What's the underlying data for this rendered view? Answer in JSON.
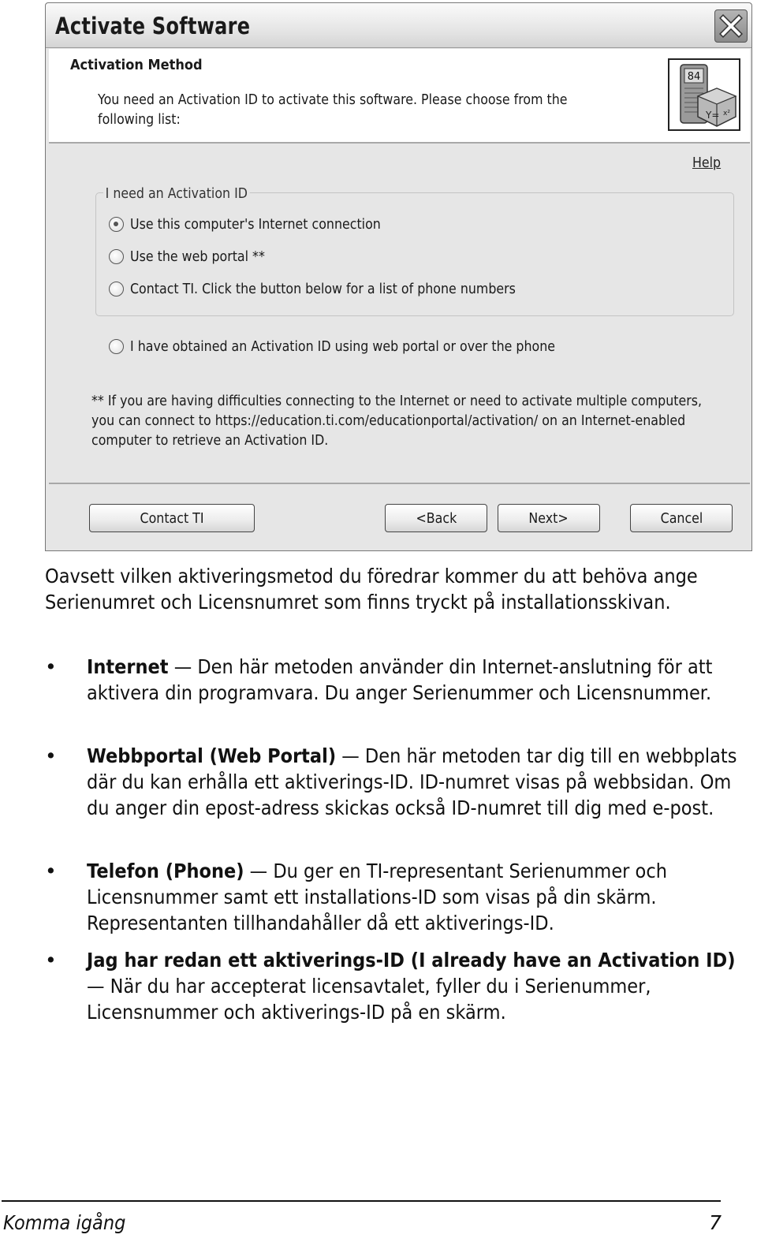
{
  "dialog": {
    "title": "Activate Software",
    "close_icon": "close-x-icon",
    "header": {
      "heading": "Activation Method",
      "description": "You need an Activation ID to activate this software. Please choose from the following list:",
      "app_icon": "ti84-calculator-cube-icon",
      "app_icon_text": "84"
    },
    "help_link": "Help",
    "group": {
      "legend": "I need an Activation ID",
      "options": [
        {
          "label": "Use this computer's Internet connection",
          "checked": true
        },
        {
          "label": "Use the web portal **",
          "checked": false
        },
        {
          "label": "Contact TI. Click the button below for a list of phone numbers",
          "checked": false
        }
      ]
    },
    "obtained_option": {
      "label": "I have obtained an Activation ID using web portal or over the phone",
      "checked": false
    },
    "footnote": "** If you are having difficulties connecting to the Internet or need to activate multiple computers, you can connect to https://education.ti.com/educationportal/activation/ on an Internet-enabled computer to retrieve an Activation ID.",
    "buttons": {
      "contact": "Contact TI",
      "back": "<Back",
      "next": "Next>",
      "cancel": "Cancel"
    }
  },
  "document": {
    "intro": "Oavsett vilken aktiveringsmetod du föredrar kommer du att behöva ange Serienumret och Licensnumret som finns tryckt på installationsskivan.",
    "bullets": [
      {
        "term": "Internet",
        "dash": " — ",
        "text": "Den här metoden använder din Internet-anslutning för att aktivera din programvara. Du anger Serienummer och Licensnummer."
      },
      {
        "term": "Webbportal (Web Portal)",
        "dash": " — ",
        "text": "Den här metoden tar dig till en webbplats där du kan erhålla ett aktiverings-ID. ID-numret visas på webbsidan. Om du anger din epost-adress skickas också ID-numret till dig med e-post."
      },
      {
        "term": "Telefon (Phone)",
        "dash": " — ",
        "text": "Du ger en TI-representant Serienummer och Licensnummer samt ett installations-ID som visas på din skärm. Representanten tillhandahåller då ett aktiverings-ID."
      },
      {
        "term": "Jag har redan ett aktiverings-ID (I already have an Activation ID)",
        "dash": " — ",
        "text": "När du har accepterat licensavtalet, fyller du i Serienummer, Licensnummer och aktiverings-ID på en skärm."
      }
    ],
    "bullet_char": "•"
  },
  "footer": {
    "section": "Komma igång",
    "page_number": "7"
  }
}
